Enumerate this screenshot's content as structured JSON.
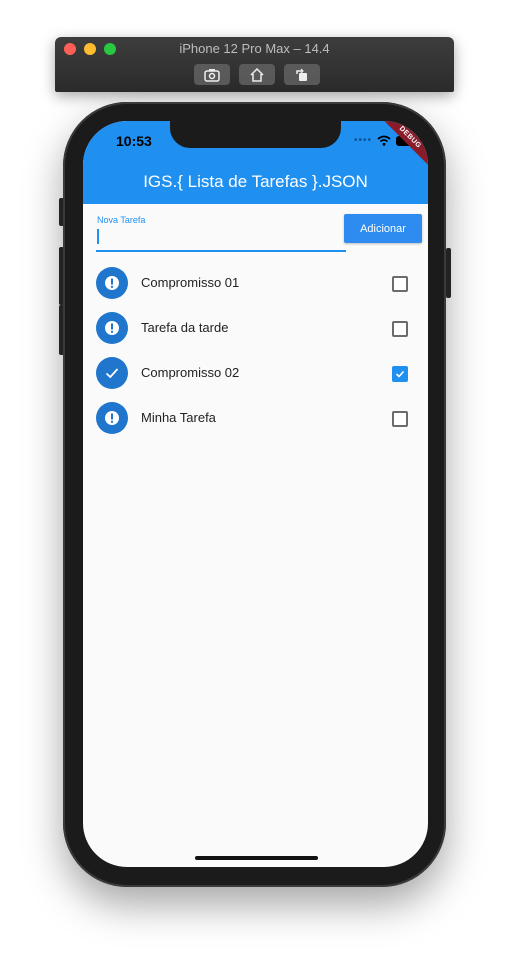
{
  "simulator": {
    "title": "iPhone 12 Pro Max – 14.4",
    "buttons": [
      {
        "icon": "screenshot-icon"
      },
      {
        "icon": "home-icon"
      },
      {
        "icon": "rotate-icon"
      }
    ]
  },
  "status_bar": {
    "time": "10:53",
    "debug_banner": "DEBUG"
  },
  "app_bar": {
    "title": "IGS.{ Lista de Tarefas }.JSON",
    "color": "#1f8ff0"
  },
  "new_task": {
    "label": "Nova Tarefa",
    "value": "",
    "add_button_label": "Adicionar"
  },
  "tasks": [
    {
      "title": "Compromisso 01",
      "done": false,
      "icon": "alert-icon"
    },
    {
      "title": "Tarefa da tarde",
      "done": false,
      "icon": "alert-icon"
    },
    {
      "title": "Compromisso 02",
      "done": true,
      "icon": "check-icon"
    },
    {
      "title": "Minha Tarefa",
      "done": false,
      "icon": "alert-icon"
    }
  ]
}
